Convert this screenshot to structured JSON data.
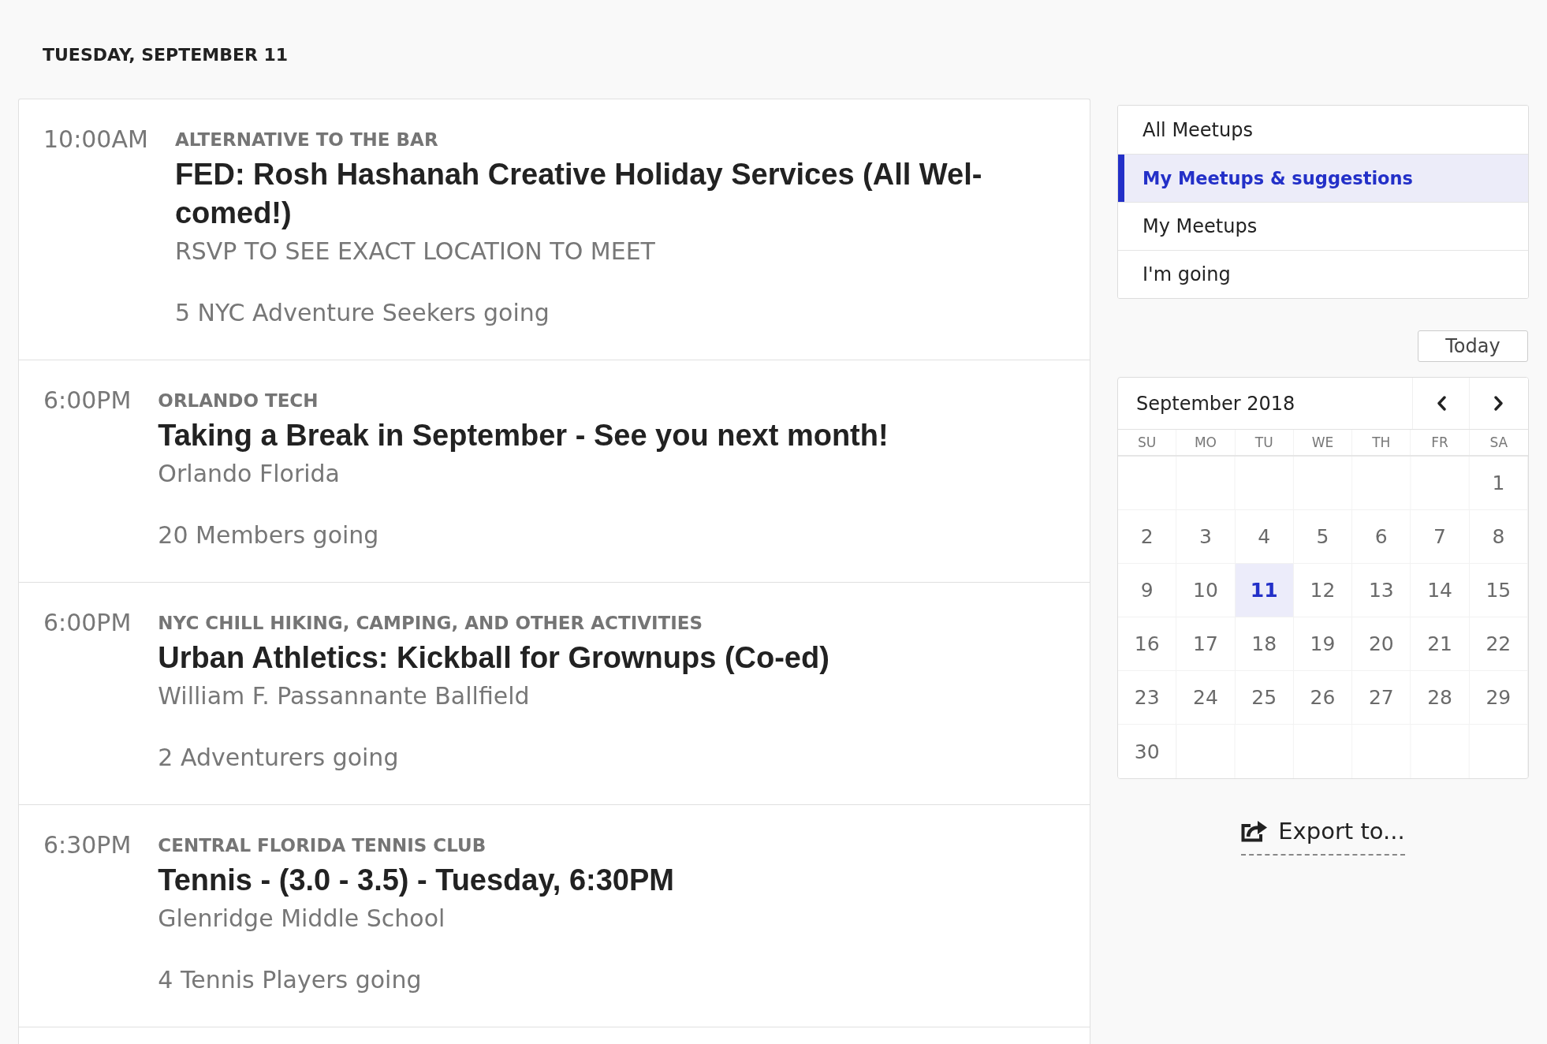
{
  "date_heading": "TUESDAY, SEPTEMBER 11",
  "events": [
    {
      "time": "10:00AM",
      "group": "ALTERNATIVE TO THE BAR",
      "title": "FED: Rosh Hashanah Creative Holiday Services (All Wel-comed!)",
      "location": "RSVP TO SEE EXACT LOCATION TO MEET",
      "attendees": "5 NYC Adventure Seekers going"
    },
    {
      "time": "6:00PM",
      "group": "ORLANDO TECH",
      "title": "Taking a Break in September - See you next month!",
      "location": "Orlando Florida",
      "attendees": "20 Members going"
    },
    {
      "time": "6:00PM",
      "group": "NYC CHILL HIKING, CAMPING, AND OTHER ACTIVITIES",
      "title": "Urban Athletics: Kickball for Grownups (Co-ed)",
      "location": "William F. Passannante Ballfield",
      "attendees": "2 Adventurers going"
    },
    {
      "time": "6:30PM",
      "group": "CENTRAL FLORIDA TENNIS CLUB",
      "title": "Tennis - (3.0 - 3.5) - Tuesday, 6:30PM",
      "location": "Glenridge Middle School",
      "attendees": "4 Tennis Players going"
    }
  ],
  "filters": [
    {
      "label": "All Meetups",
      "selected": false
    },
    {
      "label": "My Meetups & suggestions",
      "selected": true
    },
    {
      "label": "My Meetups",
      "selected": false
    },
    {
      "label": "I'm going",
      "selected": false
    }
  ],
  "today_button": "Today",
  "calendar": {
    "month_label": "September 2018",
    "weekdays": [
      "SU",
      "MO",
      "TU",
      "WE",
      "TH",
      "FR",
      "SA"
    ],
    "weeks": [
      {
        "kind": "leading",
        "days": [
          {
            "day": "1",
            "selected": false
          }
        ]
      },
      {
        "kind": "full",
        "days": [
          {
            "day": "2",
            "selected": false
          },
          {
            "day": "3",
            "selected": false
          },
          {
            "day": "4",
            "selected": false
          },
          {
            "day": "5",
            "selected": false
          },
          {
            "day": "6",
            "selected": false
          },
          {
            "day": "7",
            "selected": false
          },
          {
            "day": "8",
            "selected": false
          }
        ]
      },
      {
        "kind": "full",
        "days": [
          {
            "day": "9",
            "selected": false
          },
          {
            "day": "10",
            "selected": false
          },
          {
            "day": "11",
            "selected": true
          },
          {
            "day": "12",
            "selected": false
          },
          {
            "day": "13",
            "selected": false
          },
          {
            "day": "14",
            "selected": false
          },
          {
            "day": "15",
            "selected": false
          }
        ]
      },
      {
        "kind": "full",
        "days": [
          {
            "day": "16",
            "selected": false
          },
          {
            "day": "17",
            "selected": false
          },
          {
            "day": "18",
            "selected": false
          },
          {
            "day": "19",
            "selected": false
          },
          {
            "day": "20",
            "selected": false
          },
          {
            "day": "21",
            "selected": false
          },
          {
            "day": "22",
            "selected": false
          }
        ]
      },
      {
        "kind": "full",
        "days": [
          {
            "day": "23",
            "selected": false
          },
          {
            "day": "24",
            "selected": false
          },
          {
            "day": "25",
            "selected": false
          },
          {
            "day": "26",
            "selected": false
          },
          {
            "day": "27",
            "selected": false
          },
          {
            "day": "28",
            "selected": false
          },
          {
            "day": "29",
            "selected": false
          }
        ]
      },
      {
        "kind": "trailing",
        "days": [
          {
            "day": "30",
            "selected": false
          }
        ]
      }
    ]
  },
  "export_link": "Export to..."
}
